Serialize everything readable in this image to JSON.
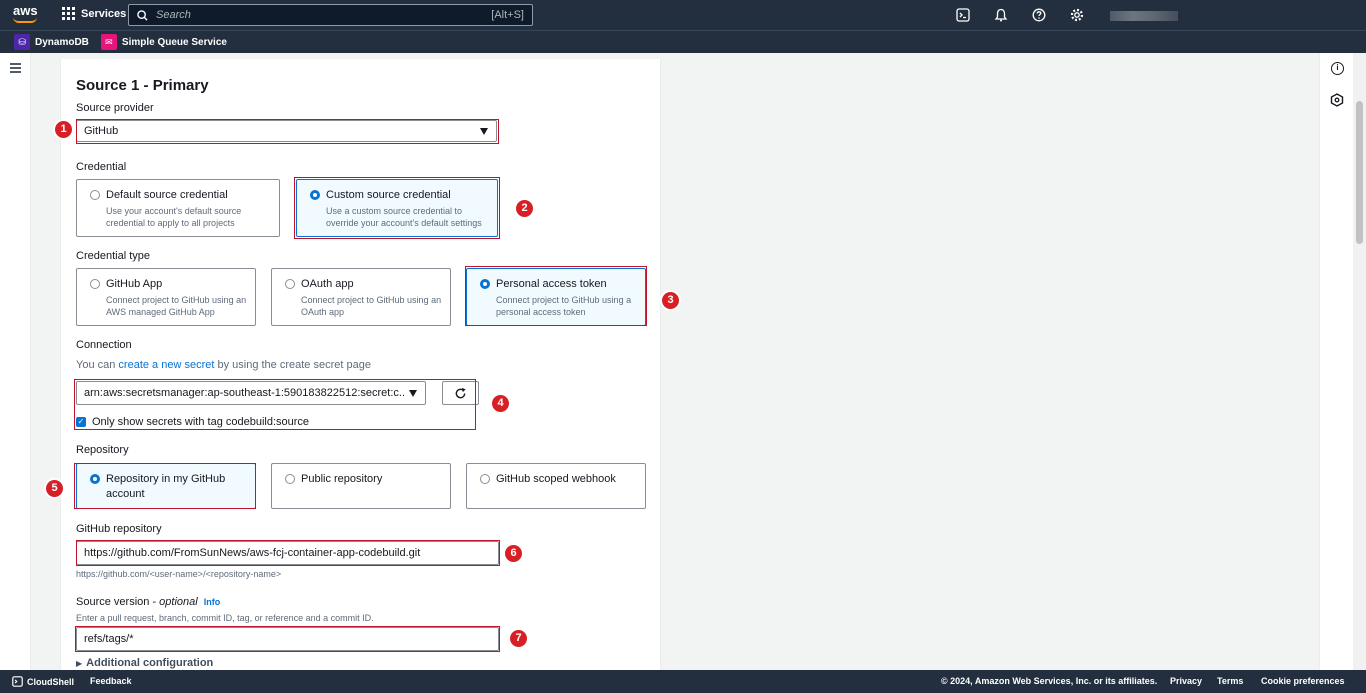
{
  "topnav": {
    "logo": "aws",
    "services_label": "Services",
    "search_placeholder": "Search",
    "search_shortcut": "[Alt+S]",
    "icons": [
      "cloudshell-icon",
      "notifications-icon",
      "help-icon",
      "settings-icon"
    ]
  },
  "favorites": [
    {
      "label": "DynamoDB",
      "color": "#4d27aa"
    },
    {
      "label": "Simple Queue Service",
      "color": "#e7157b"
    }
  ],
  "source": {
    "heading": "Source 1 - Primary",
    "provider_label": "Source provider",
    "provider_value": "GitHub",
    "credential_label": "Credential",
    "credential_options": [
      {
        "title": "Default source credential",
        "desc": "Use your account's default source credential to apply to all projects",
        "selected": false
      },
      {
        "title": "Custom source credential",
        "desc": "Use a custom source credential to override your account's default settings",
        "selected": true
      }
    ],
    "credential_type_label": "Credential type",
    "credential_type_options": [
      {
        "title": "GitHub App",
        "desc": "Connect project to GitHub using an AWS managed GitHub App",
        "selected": false
      },
      {
        "title": "OAuth app",
        "desc": "Connect project to GitHub using an OAuth app",
        "selected": false
      },
      {
        "title": "Personal access token",
        "desc": "Connect project to GitHub using a personal access token",
        "selected": true
      }
    ],
    "connection_label": "Connection",
    "connection_hint_prefix": "You can ",
    "connection_hint_link": "create a new secret",
    "connection_hint_suffix": " by using the create secret page",
    "connection_value": "arn:aws:secretsmanager:ap-southeast-1:590183822512:secret:c...",
    "only_show_label": "Only show secrets with tag codebuild:source",
    "repository_label": "Repository",
    "repository_options": [
      {
        "title": "Repository in my GitHub account",
        "selected": true
      },
      {
        "title": "Public repository",
        "selected": false
      },
      {
        "title": "GitHub scoped webhook",
        "selected": false
      }
    ],
    "github_repo_label": "GitHub repository",
    "github_repo_value": "https://github.com/FromSunNews/aws-fcj-container-app-codebuild.git",
    "github_repo_hint": "https://github.com/<user-name>/<repository-name>",
    "source_version_label": "Source version",
    "source_version_optional": " - optional",
    "info_link": "Info",
    "source_version_hint": "Enter a pull request, branch, commit ID, tag, or reference and a commit ID.",
    "source_version_value": "refs/tags/*",
    "additional_config": "Additional configuration"
  },
  "steps": [
    "1",
    "2",
    "3",
    "4",
    "5",
    "6",
    "7"
  ],
  "footer": {
    "cloudshell": "CloudShell",
    "feedback": "Feedback",
    "copyright": "© 2024, Amazon Web Services, Inc. or its affiliates.",
    "privacy": "Privacy",
    "terms": "Terms",
    "cookie": "Cookie preferences"
  }
}
